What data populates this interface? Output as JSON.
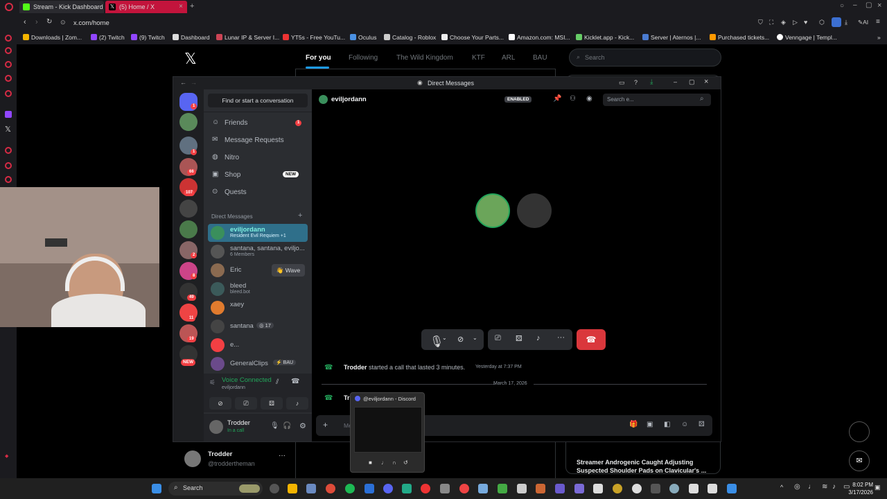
{
  "browser": {
    "tabs": [
      {
        "label": "Stream - Kick Dashboard",
        "color": "#53fc18"
      },
      {
        "label": "(5) Home / X",
        "color": "#000000"
      }
    ],
    "url": "x.com/home",
    "bookmarks": [
      "Downloads | Zom...",
      "(2) Twitch",
      "(9) Twitch",
      "Dashboard",
      "Lunar IP & Server I...",
      "YT5s - Free YouTu...",
      "Oculus",
      "Catalog - Roblox",
      "Choose Your Parts...",
      "Amazon.com: MSI...",
      "Kicklet.app - Kick...",
      "Server | Aternos |...",
      "Purchased tickets...",
      "Venngage | Templ..."
    ],
    "ai_label": "AI"
  },
  "x": {
    "tabs": [
      "For you",
      "Following",
      "The Wild Kingdom",
      "KTF",
      "ARL",
      "BAU"
    ],
    "search_placeholder": "Search",
    "profile_name": "Trodder",
    "profile_handle": "@troddertheman",
    "news": "Streamer Androgenic Caught Adjusting Suspected Shoulder Pads on Clavicular's ..."
  },
  "discord": {
    "window_title": "Direct Messages",
    "find_placeholder": "Find or start a conversation",
    "nav": [
      {
        "label": "Friends",
        "badge": "1"
      },
      {
        "label": "Message Requests"
      },
      {
        "label": "Nitro"
      },
      {
        "label": "Shop",
        "tag": "NEW"
      },
      {
        "label": "Quests"
      }
    ],
    "dm_header": "Direct Messages",
    "dms": [
      {
        "name": "eviljordann",
        "sub": "Resident Evil Requiem +1",
        "color": "#3a8f5c"
      },
      {
        "name": "santana, santana, eviljo...",
        "sub": "6 Members",
        "color": "#555"
      },
      {
        "name": "Eric",
        "sub": "",
        "action": "Wave",
        "color": "#8a6a50"
      },
      {
        "name": "bleed",
        "sub": "bleed.bot",
        "color": "#3b5a5a"
      },
      {
        "name": "xaey",
        "sub": "",
        "color": "#e07b2e"
      },
      {
        "name": "santana",
        "sub": "",
        "count": "17",
        "color": "#444"
      },
      {
        "name": "e...",
        "sub": "",
        "color": "#f23f43"
      },
      {
        "name": "GeneralClips",
        "sub": "",
        "tag": "BAU",
        "color": "#6a4a8a"
      }
    ],
    "server_badges": [
      "1",
      "1",
      "66",
      "107",
      "2",
      "8",
      "49",
      "11",
      "19",
      "NEW"
    ],
    "voice": {
      "status": "Voice Connected",
      "channel": "eviljordann"
    },
    "user": {
      "name": "Trodder",
      "status": "In a call"
    },
    "header_name": "eviljordann",
    "enabled_label": "ENABLED",
    "search_placeholder": "Search e...",
    "messages": [
      {
        "user": "Trodder",
        "text": "started a call that lasted 3 minutes.",
        "time": "Yesterday at 7:37 PM"
      },
      {
        "user": "Tr",
        "text": "",
        "time": ""
      }
    ],
    "date_divider": "March 17, 2026",
    "message_placeholder": "Me",
    "popup_title": "@eviljordann - Discord"
  },
  "taskbar": {
    "search": "Search",
    "time": "8:02 PM",
    "date": "3/17/2026"
  }
}
